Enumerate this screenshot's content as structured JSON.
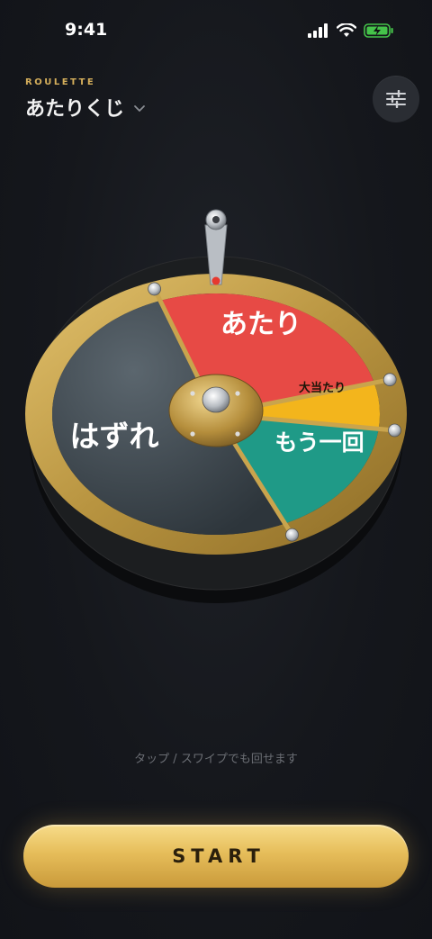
{
  "status_bar": {
    "time": "9:41"
  },
  "header": {
    "eyebrow": "ROULETTE",
    "title": "あたりくじ"
  },
  "wheel": {
    "segments": [
      {
        "label": "あたり",
        "color": "#e74a45"
      },
      {
        "label": "大当たり",
        "color": "#f3b51c"
      },
      {
        "label": "もう一回",
        "color": "#1f9a87"
      },
      {
        "label": "はずれ",
        "color": "#3f4a52"
      }
    ],
    "rim_color": "#c9a44d"
  },
  "hint": "タップ / スワイプでも回せます",
  "start_button": {
    "label": "START"
  },
  "colors": {
    "accent": "#d4ae5b",
    "background": "#15171c"
  }
}
